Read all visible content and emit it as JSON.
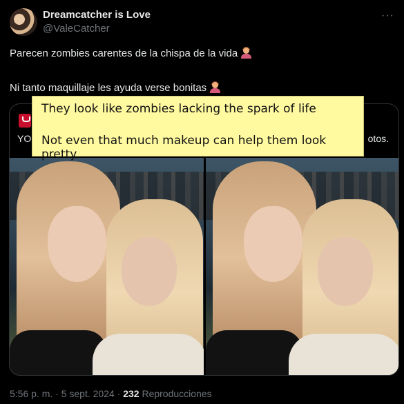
{
  "tweet": {
    "display_name": "Dreamcatcher is Love",
    "handle": "@ValeCatcher",
    "more_label": "···",
    "line1": "Parecen zombies carentes de la chispa de la vida",
    "line2": "Ni tanto maquillaje les ayuda verse bonitas",
    "emoji": "woman-tipping-hand-emoji"
  },
  "quoted_card": {
    "text_left": "YO",
    "text_right": "otos."
  },
  "translation_overlay": {
    "line1": "They look like zombies lacking the spark of life",
    "line2": "Not even that much makeup can help them look pretty"
  },
  "footer": {
    "time_date": "5:56 p. m. · 5 sept. 2024 ·",
    "views_count": "232",
    "views_label": "Reproducciones"
  }
}
